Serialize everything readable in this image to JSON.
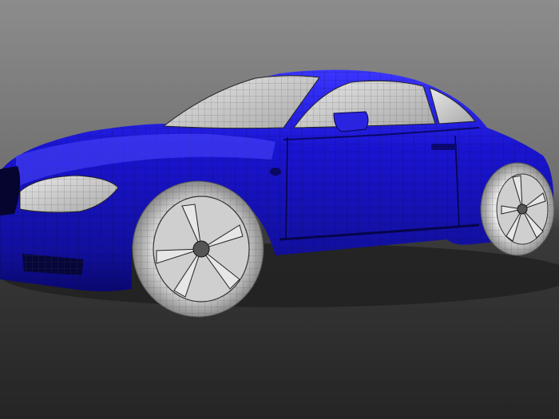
{
  "scene": {
    "subject": "car-wireframe-render",
    "colors": {
      "background_top": "#8a8a8a",
      "background_mid": "#6f6f6f",
      "floor": "#2a2a2a",
      "body": "#1a14c8",
      "body_dark": "#0c0a7a",
      "body_light": "#4a44ff",
      "glass": "#d8d8d8",
      "wire": "#0a0a3a",
      "tire": "#d9d9d9",
      "rim": "#bdbdbd"
    }
  }
}
